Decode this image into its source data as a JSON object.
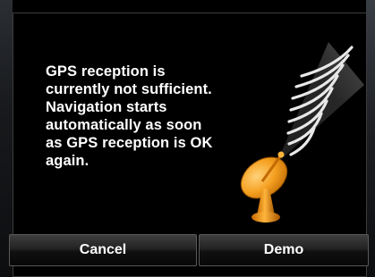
{
  "dialog": {
    "message_lines": [
      "GPS reception is",
      "currently not sufficient.",
      "Navigation starts",
      "automatically as soon",
      "as GPS reception is OK",
      "again."
    ],
    "illustration_icon": "satellite-dish-icon"
  },
  "buttons": {
    "cancel_label": "Cancel",
    "demo_label": "Demo"
  },
  "colors": {
    "background": "#000000",
    "text": "#ffffff",
    "dish_accent": "#f39a1a"
  }
}
